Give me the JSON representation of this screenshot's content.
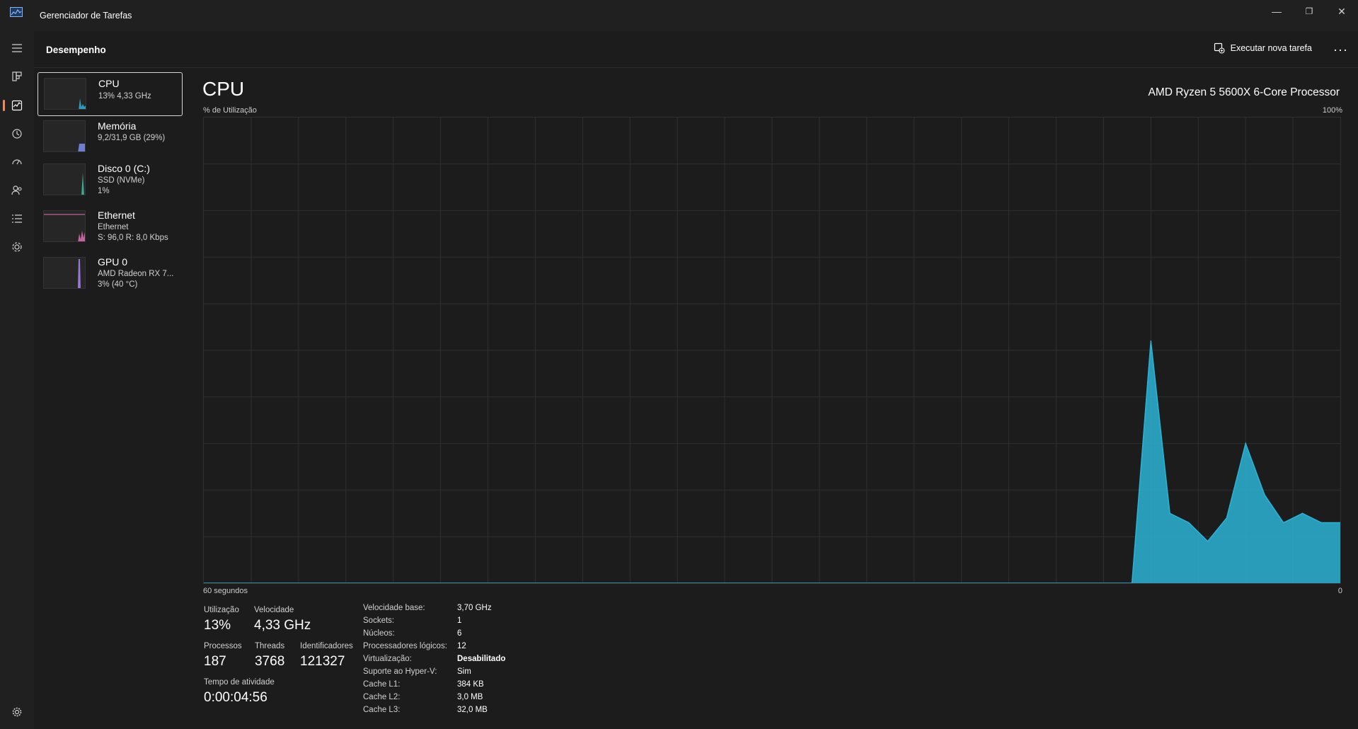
{
  "titlebar": {
    "title": "Gerenciador de Tarefas",
    "minimize_glyph": "—",
    "restore_glyph": "❐",
    "close_glyph": "✕"
  },
  "nav": {
    "items": [
      "menu-icon",
      "processes-icon",
      "performance-icon",
      "app-history-icon",
      "startup-apps-icon",
      "users-icon",
      "details-icon",
      "services-icon"
    ],
    "settings_icon": "gear-icon",
    "active_color": "#f08a5d"
  },
  "header": {
    "title": "Desempenho",
    "run_task_label": "Executar nova tarefa",
    "more_glyph": "···"
  },
  "resources": [
    {
      "name": "CPU",
      "line1": "13%  4,33 GHz",
      "line2": "",
      "color": "#2bb3d6",
      "selected": true
    },
    {
      "name": "Memória",
      "line1": "9,2/31,9 GB (29%)",
      "line2": "",
      "color": "#7b8ff0",
      "selected": false
    },
    {
      "name": "Disco 0 (C:)",
      "line1": "SSD (NVMe)",
      "line2": "1%",
      "color": "#3fc3a7",
      "selected": false
    },
    {
      "name": "Ethernet",
      "line1": "Ethernet",
      "line2": "S: 96,0  R: 8,0 Kbps",
      "color": "#e06fb9",
      "selected": false
    },
    {
      "name": "GPU 0",
      "line1": "AMD Radeon RX 7...",
      "line2": "3%  (40 °C)",
      "color": "#a77ff0",
      "selected": false
    }
  ],
  "main": {
    "title": "CPU",
    "model": "AMD Ryzen 5 5600X 6-Core Processor",
    "y_label": "% de Utilização",
    "y_max": "100%",
    "x_label": "60 segundos",
    "x_min": "0"
  },
  "chart_data": {
    "type": "area",
    "title": "CPU",
    "xlabel": "60 segundos",
    "ylabel": "% de Utilização",
    "ylim": [
      0,
      100
    ],
    "xlim": [
      0,
      60
    ],
    "grid": true,
    "color": "#2bb3d6",
    "series": [
      {
        "x": [
          0,
          49,
          50,
          51,
          52,
          53,
          54,
          55,
          56,
          57,
          58,
          59,
          60
        ],
        "values": [
          0,
          0,
          52,
          15,
          13,
          9,
          14,
          30,
          19,
          13,
          15,
          13,
          13
        ]
      }
    ]
  },
  "stats": {
    "utilization_label": "Utilização",
    "utilization": "13%",
    "speed_label": "Velocidade",
    "speed": "4,33 GHz",
    "processes_label": "Processos",
    "processes": "187",
    "threads_label": "Threads",
    "threads": "3768",
    "handles_label": "Identificadores",
    "handles": "121327",
    "uptime_label": "Tempo de atividade",
    "uptime": "0:00:04:56"
  },
  "details": [
    {
      "key": "Velocidade base:",
      "value": "3,70 GHz",
      "bold": false
    },
    {
      "key": "Sockets:",
      "value": "1",
      "bold": false
    },
    {
      "key": "Núcleos:",
      "value": "6",
      "bold": false
    },
    {
      "key": "Processadores lógicos:",
      "value": "12",
      "bold": false
    },
    {
      "key": "Virtualização:",
      "value": "Desabilitado",
      "bold": true
    },
    {
      "key": "Suporte ao Hyper-V:",
      "value": "Sim",
      "bold": false
    },
    {
      "key": "Cache L1:",
      "value": "384 KB",
      "bold": false
    },
    {
      "key": "Cache L2:",
      "value": "3,0 MB",
      "bold": false
    },
    {
      "key": "Cache L3:",
      "value": "32,0 MB",
      "bold": false
    }
  ]
}
